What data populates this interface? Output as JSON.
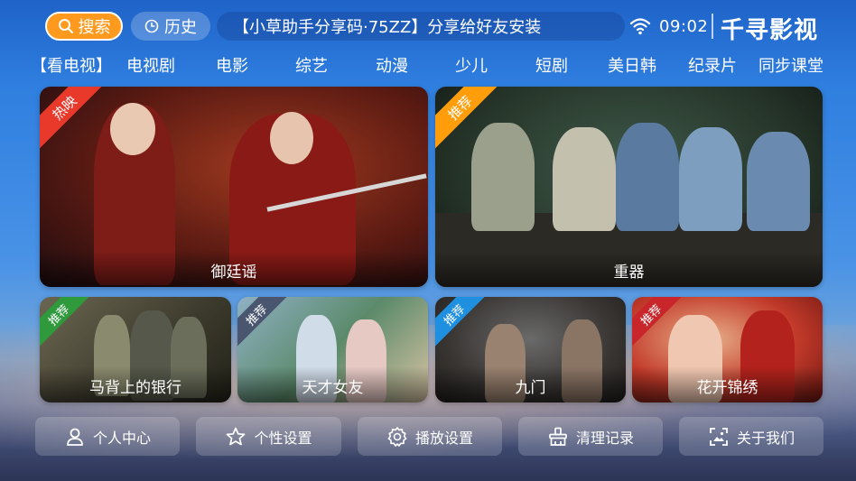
{
  "topbar": {
    "search_label": "搜索",
    "history_label": "历史",
    "marquee_text": "【小草助手分享码·75ZZ】分享给好友安装",
    "time": "09:02",
    "brand": "千寻影视"
  },
  "nav": {
    "items": [
      "【看电视】",
      "电视剧",
      "电影",
      "综艺",
      "动漫",
      "少儿",
      "短剧",
      "美日韩",
      "纪录片",
      "同步课堂"
    ]
  },
  "featured": [
    {
      "title": "御廷谣",
      "badge": "热映",
      "badge_color": "#e8392b"
    },
    {
      "title": "重器",
      "badge": "推荐",
      "badge_color": "#ff9d0a"
    }
  ],
  "recommended": [
    {
      "title": "马背上的银行",
      "badge": "推荐",
      "badge_color": "#2e9a3c"
    },
    {
      "title": "天才女友",
      "badge": "推荐",
      "badge_color": "#4a5670"
    },
    {
      "title": "九门",
      "badge": "推荐",
      "badge_color": "#1f8fe0"
    },
    {
      "title": "花开锦绣",
      "badge": "推荐",
      "badge_color": "#c8262a"
    }
  ],
  "bottom_buttons": [
    {
      "label": "个人中心",
      "icon": "person-icon"
    },
    {
      "label": "个性设置",
      "icon": "star-icon"
    },
    {
      "label": "播放设置",
      "icon": "gear-icon"
    },
    {
      "label": "清理记录",
      "icon": "broom-icon"
    },
    {
      "label": "关于我们",
      "icon": "image-frame-icon"
    }
  ]
}
